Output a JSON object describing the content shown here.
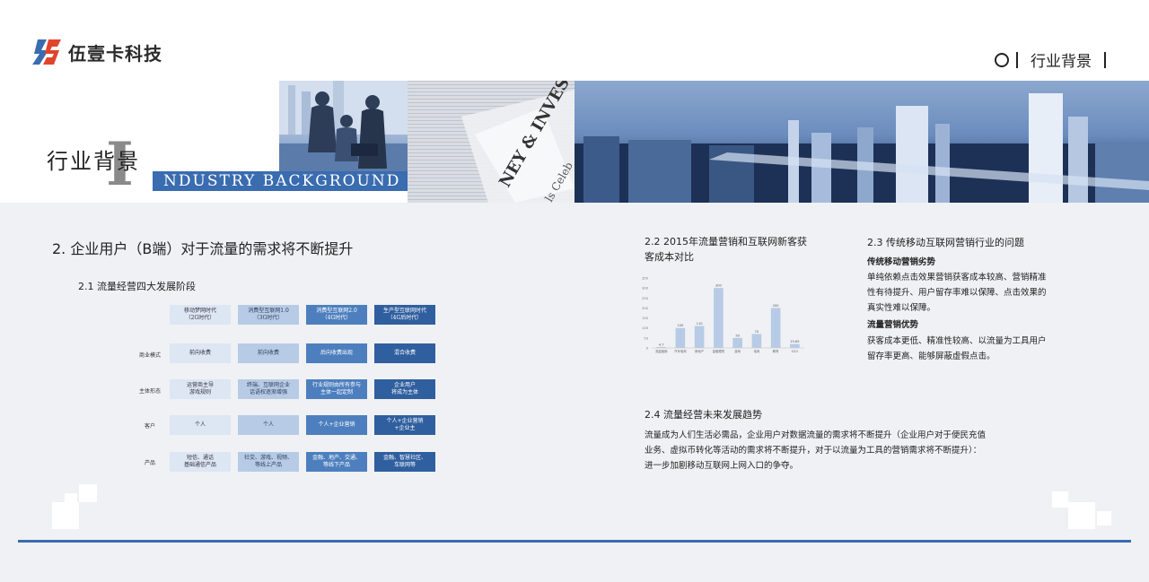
{
  "brand": {
    "name": "伍壹卡科技"
  },
  "section_tag": {
    "label": "行业背景"
  },
  "banner": {
    "title": "行业背景",
    "big_letter": "I",
    "strip_text": "NDUSTRY BACKGROUND"
  },
  "heading_main": "2. 企业用户（B端）对于流量的需求将不断提升",
  "sec21": {
    "title": "2.1  流量经营四大发展阶段",
    "columns": [
      "移动梦网时代\n（2G时代）",
      "消费型互联网1.0\n（3G时代）",
      "消费型互联网2.0\n（4G时代）",
      "生产型互联网时代\n（4G后时代）"
    ],
    "rows": [
      {
        "label": "商业模式",
        "cells": [
          "前向收费",
          "前向收费",
          "后向收费出现",
          "混合收费"
        ]
      },
      {
        "label": "主体形态",
        "cells": [
          "运营商主导\n游戏规则",
          "终端、互联网企业\n话语权逐渐增强",
          "行业规则由所有参与\n主体一起定制",
          "企业用户\n将成为主体"
        ]
      },
      {
        "label": "客户",
        "cells": [
          "个人",
          "个人",
          "个人+企业营销",
          "个人+企业营销\n+企业主"
        ]
      },
      {
        "label": "产品",
        "cells": [
          "短信、通话\n基础通信产品",
          "社交、游戏、视频、\n等线上产品",
          "金融、地产、交通、\n等线下产品",
          "金融、智慧社区、\n车联网等"
        ]
      }
    ]
  },
  "sec22": {
    "title": "2.2  2015年流量营销和互联网新客获客成本对比"
  },
  "chart_data": {
    "type": "bar",
    "title": "",
    "ylim": [
      0,
      350
    ],
    "yticks": [
      "350",
      "300",
      "250",
      "200",
      "150",
      "100",
      "50",
      "0"
    ],
    "categories": [
      "流量营销",
      "汽车电商",
      "房地产",
      "金融理财",
      "游戏",
      "电商",
      "教育",
      "O2O"
    ],
    "values": [
      4.7,
      100,
      110,
      300,
      50,
      70,
      200,
      19.65
    ],
    "value_labels": [
      "4.7",
      "100",
      "110",
      "300",
      "50",
      "70",
      "200",
      "19.65"
    ],
    "bar_color": "#b7cbe6"
  },
  "sec23": {
    "title": "2.3  传统移动互联网营销行业的问题",
    "sub1": "传统移动营销劣势",
    "lines1": [
      "单纯依赖点击效果营销获客成本较高、营销精准",
      "性有待提升、用户留存率难以保障、点击效果的",
      "真实性难以保障。"
    ],
    "sub2": "流量营销优势",
    "lines2": [
      "获客成本更低、精准性较高、以流量为工具用户",
      "留存率更高、能够屏蔽虚假点击。"
    ]
  },
  "sec24": {
    "title": "2.4  流量经营未来发展趋势",
    "lines": [
      "流量成为人们生活必需品，企业用户对数据流量的需求将不断提升（企业用户对于便民充值",
      "业务、虚拟币转化等活动的需求将不断提升，对于以流量为工具的营销需求将不断提升）：",
      "进一步加剧移动互联网上网入口的争夺。"
    ]
  },
  "colors": {
    "accent": "#3a6cb0",
    "light": "#dde6f3",
    "mid": "#b7cbe6",
    "dark": "#2f5f9f"
  }
}
